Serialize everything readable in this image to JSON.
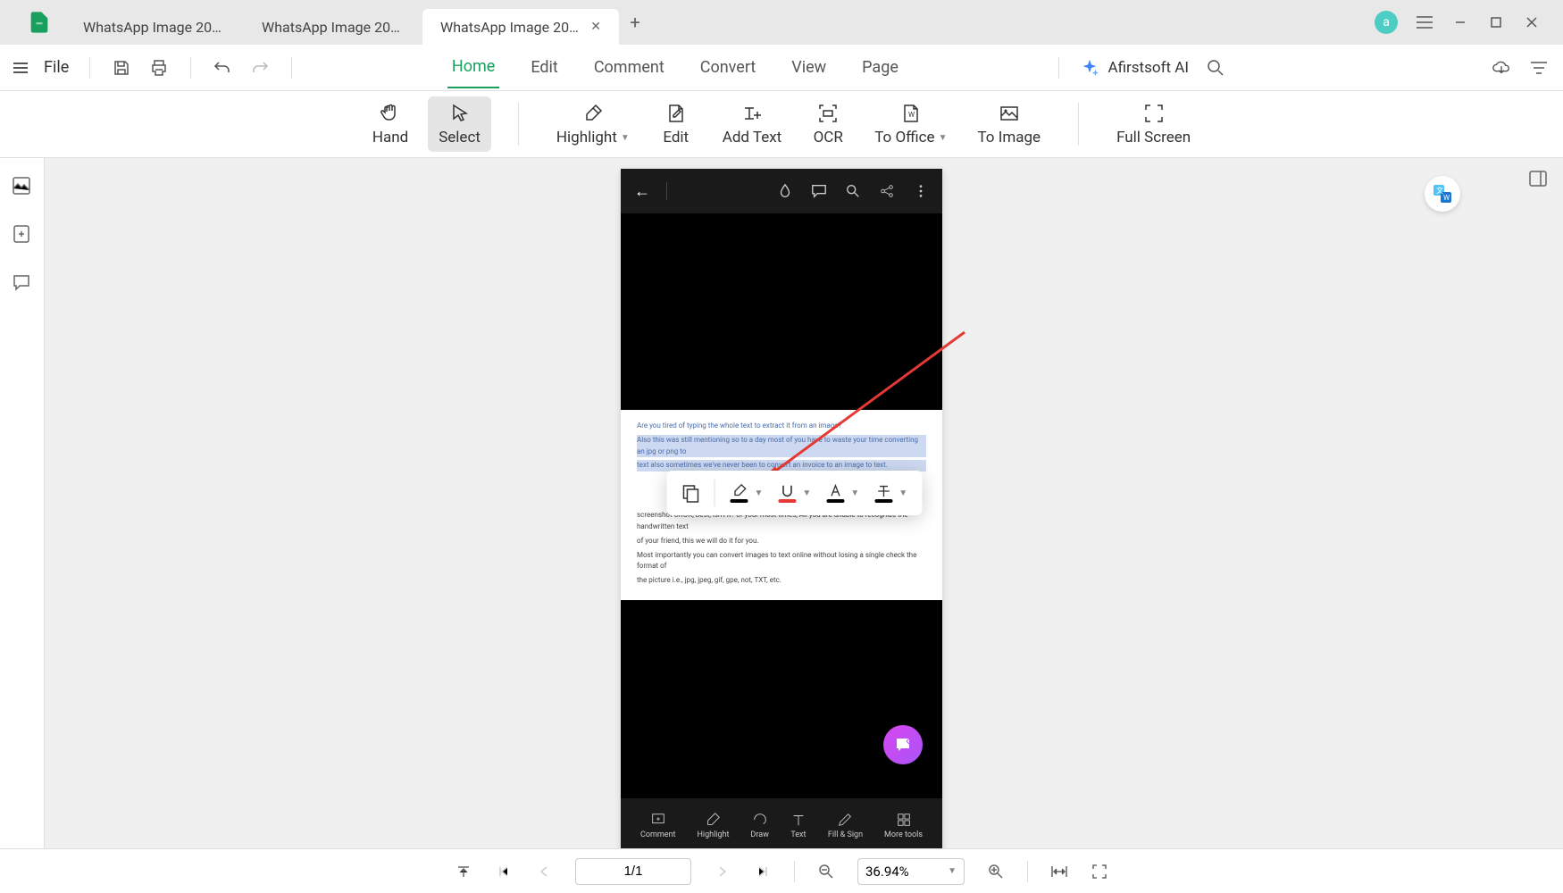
{
  "app": {
    "name": "PDF Editor"
  },
  "tabs": [
    {
      "label": "WhatsApp Image 2024-0...",
      "active": false
    },
    {
      "label": "WhatsApp Image 2024-0...",
      "active": false
    },
    {
      "label": "WhatsApp Image 2024... *",
      "active": true
    }
  ],
  "user_badge": "a",
  "file_menu": "File",
  "menu": {
    "home": "Home",
    "edit": "Edit",
    "comment": "Comment",
    "convert": "Convert",
    "view": "View",
    "page": "Page"
  },
  "ai_label": "Afirstsoft AI",
  "toolbar": {
    "hand": "Hand",
    "select": "Select",
    "highlight": "Highlight",
    "edit": "Edit",
    "add_text": "Add Text",
    "ocr": "OCR",
    "to_office": "To Office",
    "to_image": "To Image",
    "full_screen": "Full Screen"
  },
  "phone_tools": {
    "comment": "Comment",
    "highlight": "Highlight",
    "draw": "Draw",
    "text": "Text",
    "fill_sign": "Fill & Sign",
    "more": "More tools"
  },
  "doc_text": {
    "l1": "Are you tired of typing the whole text to extract it from an image?",
    "l2": "Also this was still mentioning so to a day most of you have to waste your time converting an jpg or png to",
    "l3": "text also sometimes we've never been to convert an invoice to an image to text.",
    "l4": "screenshot CROK, best, isn't it? of your most times, All you are unable to recognize the handwritten text",
    "l5": "of your friend, this we will do it for you.",
    "l6": "Most importantly you can convert images to text online without losing a single check the format of",
    "l7": "the picture i.e., jpg, jpeg, gif, gpe, not, TXT, etc."
  },
  "bottom": {
    "page": "1/1",
    "zoom": "36.94%"
  }
}
